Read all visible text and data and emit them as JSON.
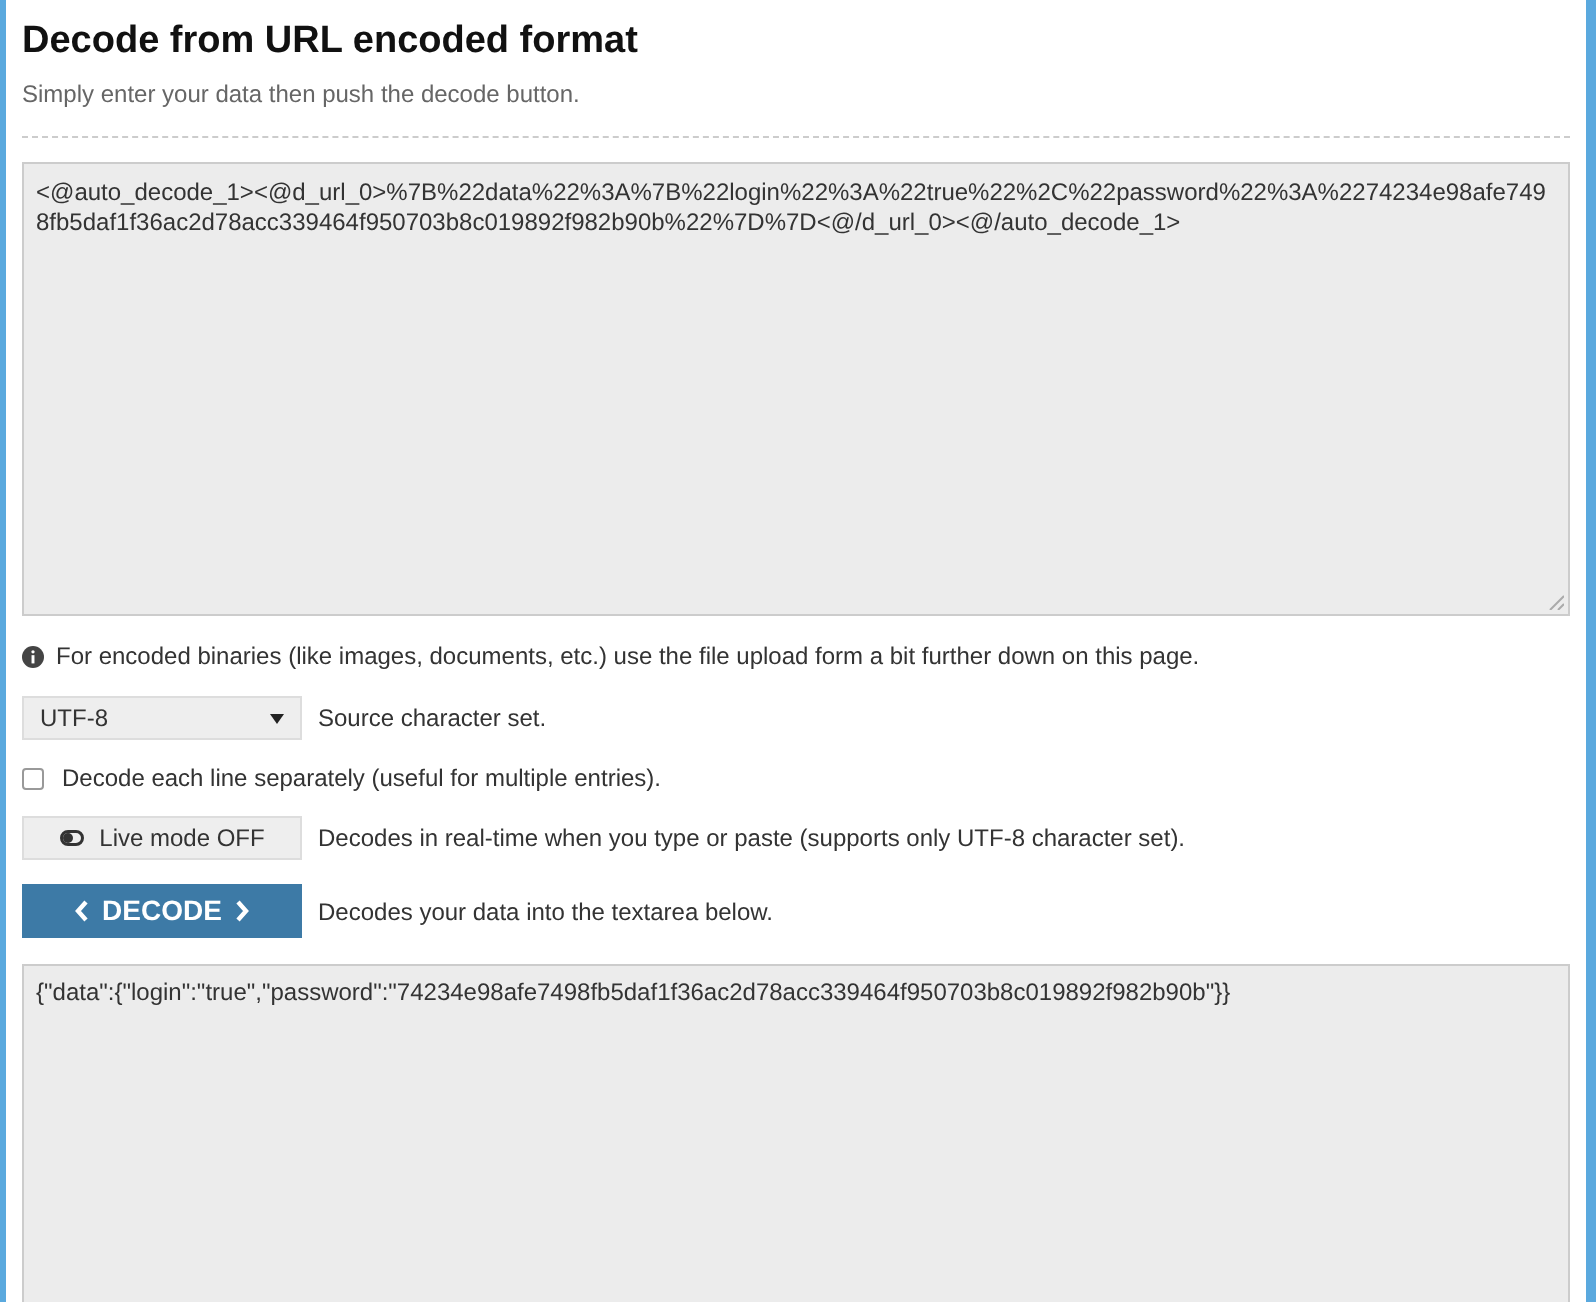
{
  "title": "Decode from URL encoded format",
  "subtitle": "Simply enter your data then push the decode button.",
  "input": {
    "value": "<@auto_decode_1><@d_url_0>%7B%22data%22%3A%7B%22login%22%3A%22true%22%2C%22password%22%3A%2274234e98afe7498fb5daf1f36ac2d78acc339464f950703b8c019892f982b90b%22%7D%7D<@/d_url_0><@/auto_decode_1>"
  },
  "info": "For encoded binaries (like images, documents, etc.) use the file upload form a bit further down on this page.",
  "charset": {
    "value": "UTF-8",
    "label": "Source character set."
  },
  "separate_lines": {
    "checked": false,
    "label": "Decode each line separately (useful for multiple entries)."
  },
  "live_mode": {
    "on": false,
    "button": "Live mode OFF",
    "label": "Decodes in real-time when you type or paste (supports only UTF-8 character set)."
  },
  "decode": {
    "button": "DECODE",
    "label": "Decodes your data into the textarea below."
  },
  "output": {
    "value": "{\"data\":{\"login\":\"true\",\"password\":\"74234e98afe7498fb5daf1f36ac2d78acc339464f950703b8c019892f982b90b\"}}"
  }
}
